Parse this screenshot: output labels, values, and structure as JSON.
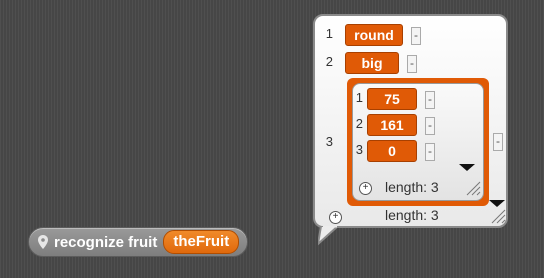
{
  "block": {
    "label": "recognize fruit",
    "variable": "theFruit"
  },
  "list": {
    "rows": [
      {
        "index": "1",
        "value": "round",
        "remove": "-"
      },
      {
        "index": "2",
        "value": "big",
        "remove": "-"
      },
      {
        "index": "3",
        "remove": "-"
      }
    ],
    "length_label": "length: 3",
    "add_symbol": "+"
  },
  "sublist": {
    "rows": [
      {
        "index": "1",
        "value": "75",
        "remove": "-"
      },
      {
        "index": "2",
        "value": "161",
        "remove": "-"
      },
      {
        "index": "3",
        "value": "0",
        "remove": "-"
      }
    ],
    "length_label": "length: 3",
    "add_symbol": "+"
  },
  "colors": {
    "block": "#8a8a8a",
    "variable": "#e8720f",
    "cell": "#e05a06"
  }
}
